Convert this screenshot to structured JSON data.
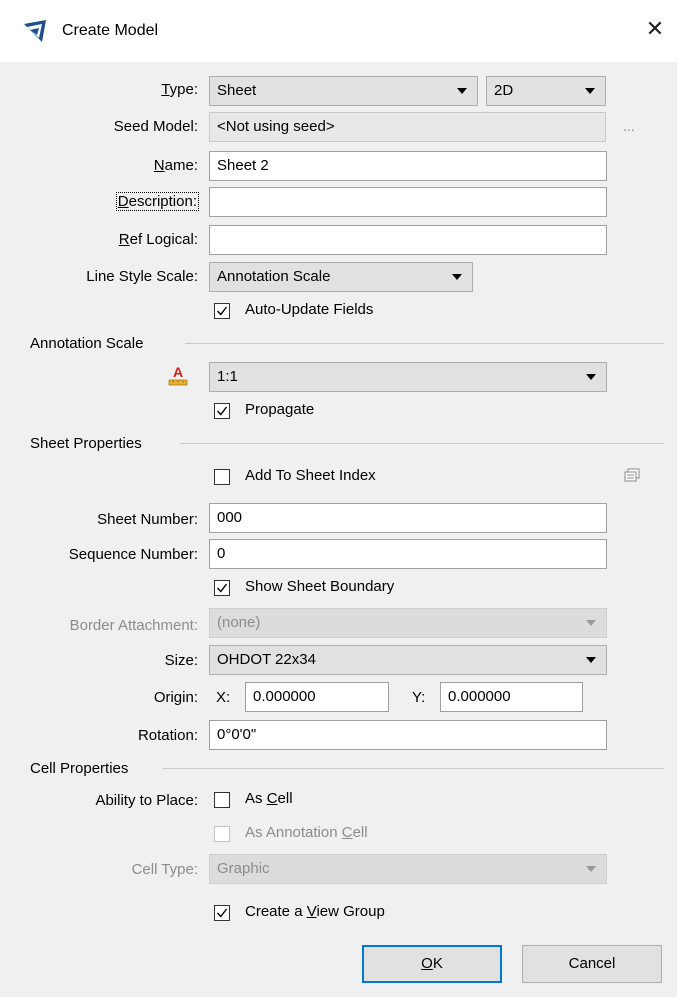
{
  "window": {
    "title": "Create Model"
  },
  "type": {
    "label": "Type:",
    "value": "Sheet",
    "dim_value": "2D"
  },
  "seed": {
    "label": "Seed Model:",
    "value": "<Not using seed>",
    "browse": "..."
  },
  "name": {
    "label": "Name:",
    "value": "Sheet 2"
  },
  "description": {
    "label": "Description:",
    "value": ""
  },
  "ref_logical": {
    "label": "Ref Logical:",
    "value": ""
  },
  "line_style_scale": {
    "label": "Line Style Scale:",
    "value": "Annotation Scale"
  },
  "auto_update": {
    "label": "Auto-Update Fields",
    "checked": true
  },
  "annotation_scale": {
    "section": "Annotation Scale",
    "value": "1:1",
    "icon": "annotation-scale-icon"
  },
  "propagate": {
    "label": "Propagate",
    "checked": true
  },
  "sheet_props": {
    "section": "Sheet Properties"
  },
  "add_to_index": {
    "label": "Add To Sheet Index",
    "checked": false
  },
  "sheet_number": {
    "label": "Sheet Number:",
    "value": "000"
  },
  "sequence_number": {
    "label": "Sequence Number:",
    "value": "0"
  },
  "show_boundary": {
    "label": "Show Sheet Boundary",
    "checked": true
  },
  "border_attachment": {
    "label": "Border Attachment:",
    "value": "(none)"
  },
  "size": {
    "label": "Size:",
    "value": "OHDOT 22x34"
  },
  "origin": {
    "label": "Origin:",
    "x_label": "X:",
    "x_value": "0.000000",
    "y_label": "Y:",
    "y_value": "0.000000"
  },
  "rotation": {
    "label": "Rotation:",
    "value": "0°0'0\""
  },
  "cell_props": {
    "section": "Cell Properties"
  },
  "ability": {
    "label": "Ability to Place:",
    "as_cell": "As Cell",
    "as_annotation_cell": "As Annotation Cell"
  },
  "cell_type": {
    "label": "Cell Type:",
    "value": "Graphic"
  },
  "view_group": {
    "label": "Create a View Group",
    "checked": true
  },
  "buttons": {
    "ok": "OK",
    "cancel": "Cancel"
  }
}
